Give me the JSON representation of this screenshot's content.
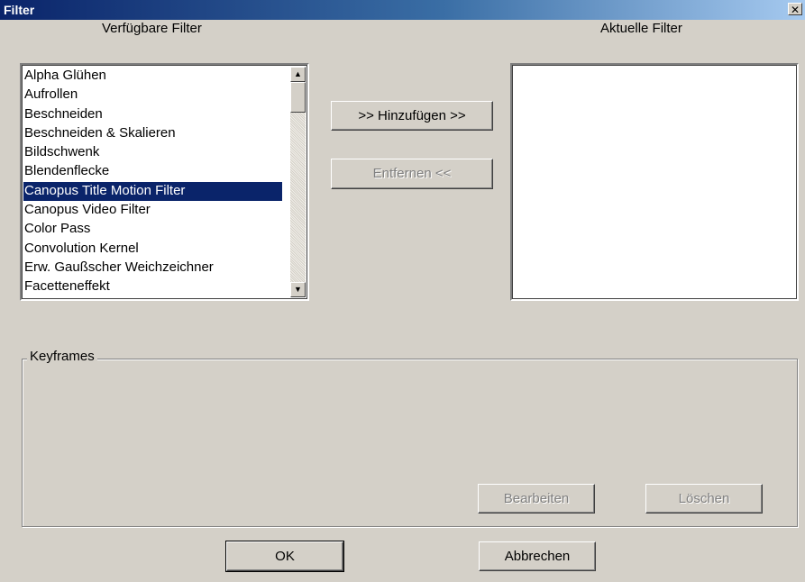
{
  "window": {
    "title": "Filter",
    "close_glyph": "✕"
  },
  "available": {
    "label": "Verfügbare Filter",
    "items": [
      {
        "label": "Alpha Glühen"
      },
      {
        "label": "Aufrollen"
      },
      {
        "label": "Beschneiden"
      },
      {
        "label": "Beschneiden & Skalieren"
      },
      {
        "label": "Bildschwenk"
      },
      {
        "label": "Blendenflecke"
      },
      {
        "label": "Canopus Title Motion Filter",
        "selected": true
      },
      {
        "label": "Canopus Video Filter"
      },
      {
        "label": "Color Pass"
      },
      {
        "label": "Convolution Kernel"
      },
      {
        "label": "Erw. Gaußscher Weichzeichner"
      },
      {
        "label": "Facetteneffekt"
      }
    ]
  },
  "current": {
    "label": "Aktuelle Filter",
    "items": []
  },
  "actions": {
    "add_label": ">> Hinzufügen >>",
    "remove_label": "Entfernen <<"
  },
  "keyframes": {
    "label": "Keyframes",
    "edit_label": "Bearbeiten",
    "delete_label": "Löschen"
  },
  "footer": {
    "ok_label": "OK",
    "cancel_label": "Abbrechen"
  },
  "icons": {
    "scroll_up": "scroll-up-arrow-icon",
    "scroll_down": "scroll-down-arrow-icon",
    "close": "close-icon"
  },
  "colors": {
    "selection": "#0a246a",
    "dialog_bg": "#d4d0c8",
    "title_start": "#0a246a",
    "title_end": "#a6caf0"
  }
}
